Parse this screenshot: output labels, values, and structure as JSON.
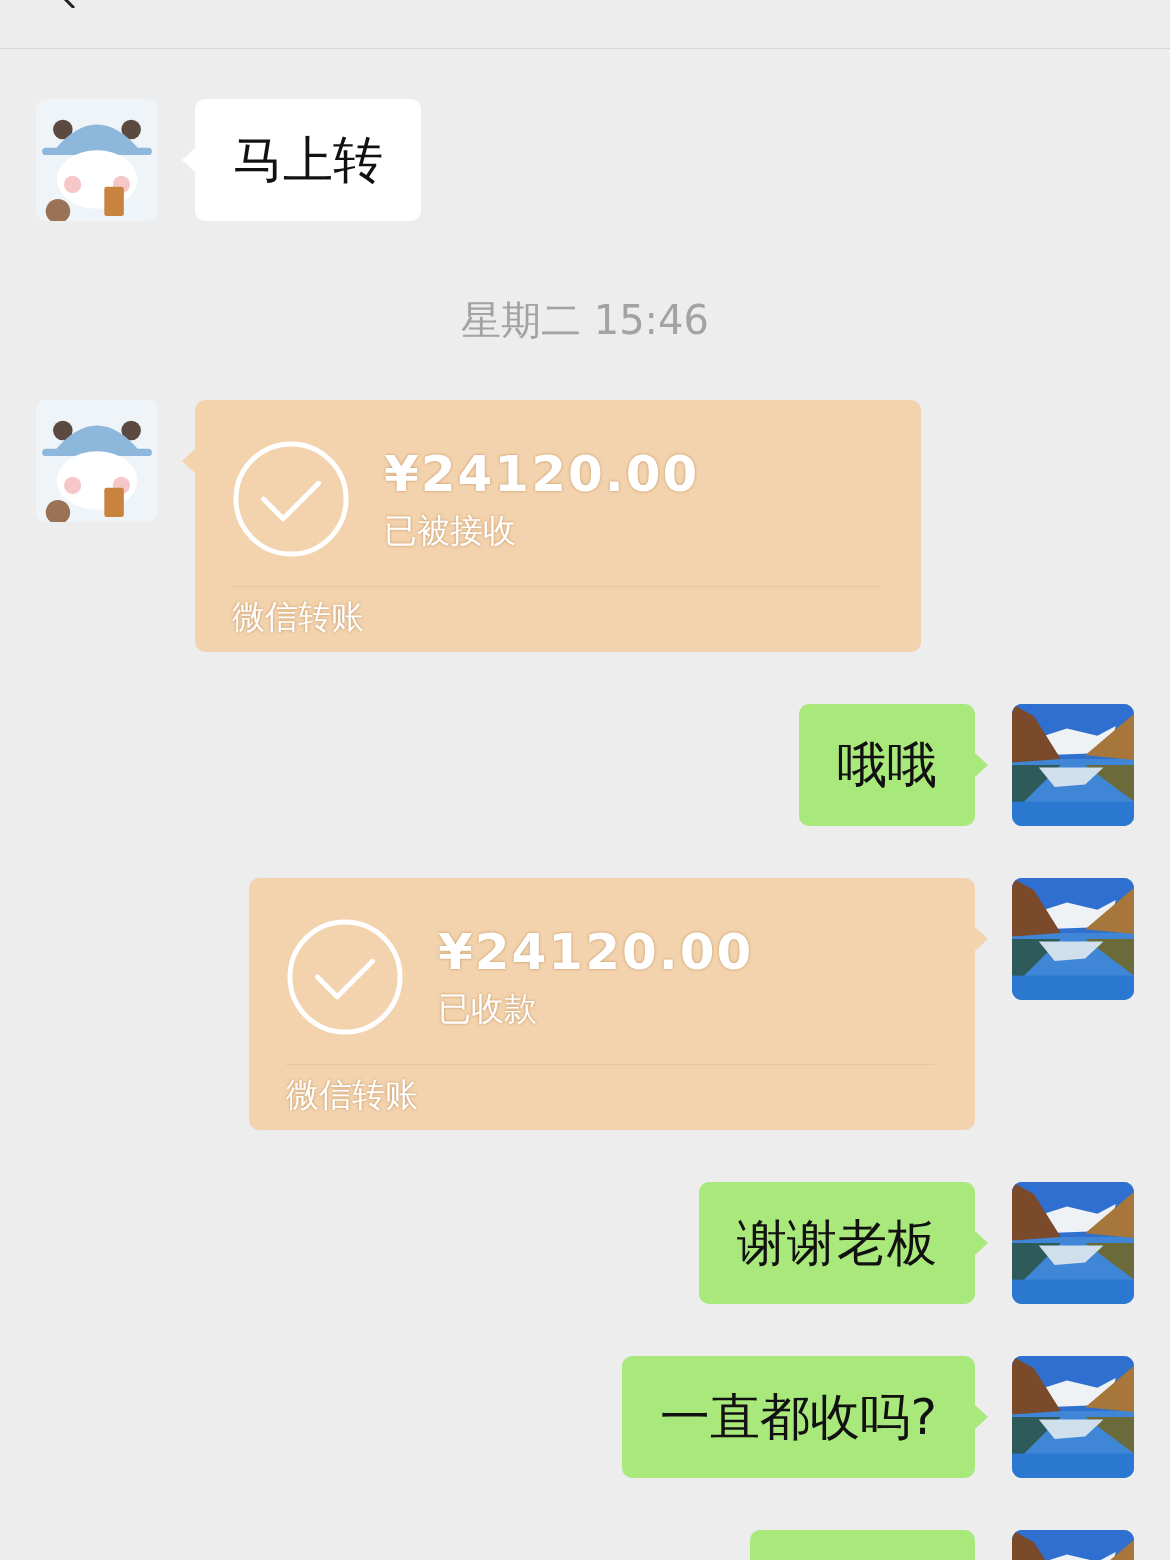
{
  "header": {
    "back": true
  },
  "messages": [
    {
      "kind": "text",
      "outgoing": false,
      "text": "马上转"
    },
    {
      "kind": "time",
      "text": "星期二 15:46"
    },
    {
      "kind": "transfer",
      "outgoing": false,
      "amount": "¥24120.00",
      "status": "已被接收",
      "footer": "微信转账"
    },
    {
      "kind": "text",
      "outgoing": true,
      "text": "哦哦"
    },
    {
      "kind": "transfer",
      "outgoing": true,
      "amount": "¥24120.00",
      "status": "已收款",
      "footer": "微信转账"
    },
    {
      "kind": "text",
      "outgoing": true,
      "text": "谢谢老板"
    },
    {
      "kind": "text",
      "outgoing": true,
      "text": "一直都收吗?"
    },
    {
      "kind": "cut",
      "outgoing": true
    }
  ]
}
